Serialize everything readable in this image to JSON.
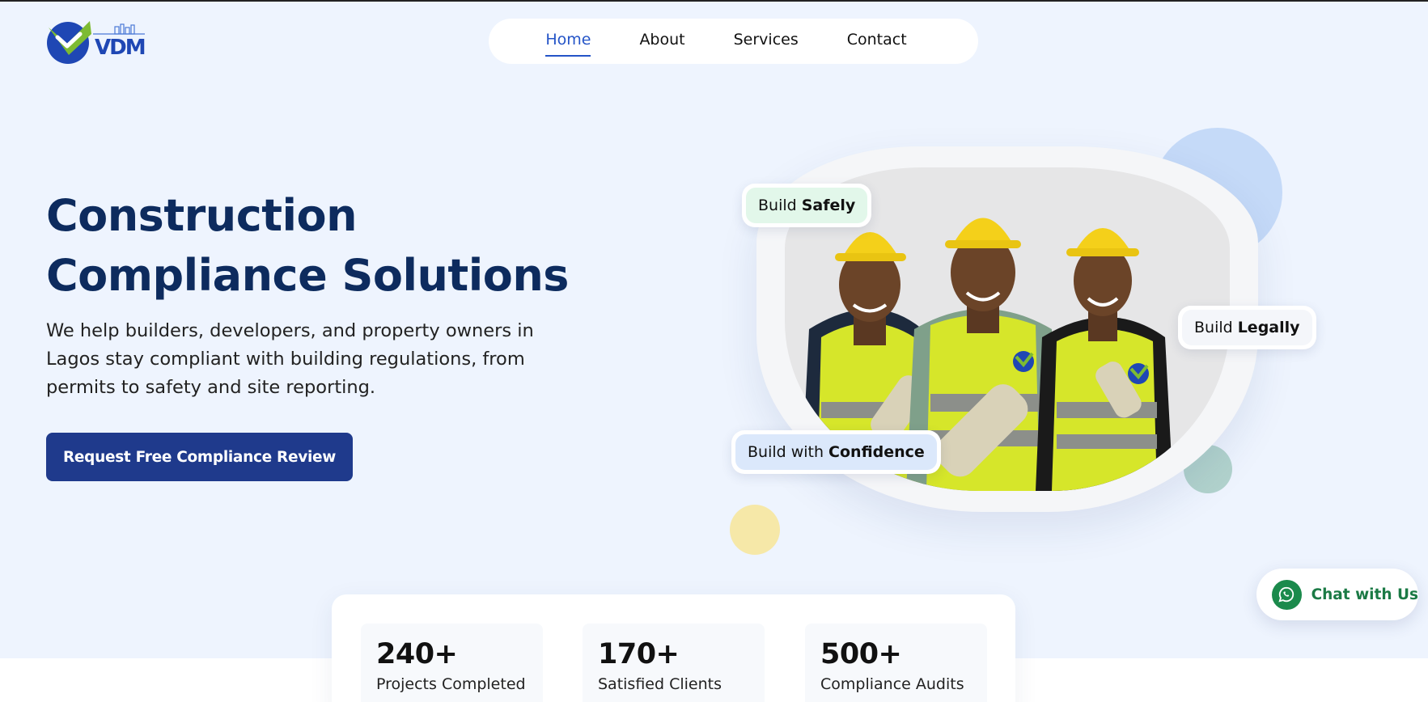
{
  "brand": {
    "wordmark": "VDM",
    "primary_color": "#1f47b4",
    "check_color": "#7dbb32"
  },
  "nav": {
    "items": [
      {
        "label": "Home",
        "active": true
      },
      {
        "label": "About",
        "active": false
      },
      {
        "label": "Services",
        "active": false
      },
      {
        "label": "Contact",
        "active": false
      }
    ]
  },
  "hero": {
    "title_line1": "Construction",
    "title_line2": "Compliance Solutions",
    "subtitle": "We help builders, developers, and property owners in Lagos stay compliant with building regulations, from permits to safety and site reporting.",
    "cta_label": "Request Free Compliance Review",
    "cta_color": "#1f3a8c"
  },
  "badges": {
    "safely": {
      "prefix": "Build",
      "emphasis": "Safely"
    },
    "legally": {
      "prefix": "Build",
      "emphasis": "Legally"
    },
    "confidence": {
      "prefix": "Build with",
      "emphasis": "Confidence"
    }
  },
  "stats": [
    {
      "value": "240+",
      "label": "Projects Completed"
    },
    {
      "value": "170+",
      "label": "Satisfied Clients"
    },
    {
      "value": "500+",
      "label": "Compliance Audits"
    }
  ],
  "chat": {
    "label": "Chat with Us",
    "icon": "whatsapp-icon",
    "color": "#1b8a4c"
  }
}
